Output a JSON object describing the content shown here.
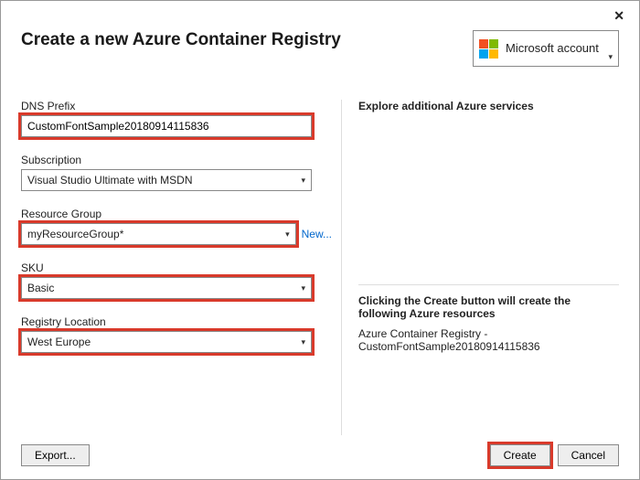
{
  "header": {
    "title": "Create a new Azure Container Registry",
    "account_label": "Microsoft account",
    "account_sub": ""
  },
  "form": {
    "dns_prefix": {
      "label": "DNS Prefix",
      "value": "CustomFontSample20180914115836"
    },
    "subscription": {
      "label": "Subscription",
      "value": "Visual Studio Ultimate with MSDN"
    },
    "resource_group": {
      "label": "Resource Group",
      "value": "myResourceGroup*",
      "new_link": "New..."
    },
    "sku": {
      "label": "SKU",
      "value": "Basic"
    },
    "location": {
      "label": "Registry Location",
      "value": "West Europe"
    }
  },
  "right": {
    "explore_title": "Explore additional Azure services",
    "note_title": "Clicking the Create button will create the following Azure resources",
    "note_body": "Azure Container Registry - CustomFontSample20180914115836"
  },
  "footer": {
    "export": "Export...",
    "create": "Create",
    "cancel": "Cancel"
  }
}
